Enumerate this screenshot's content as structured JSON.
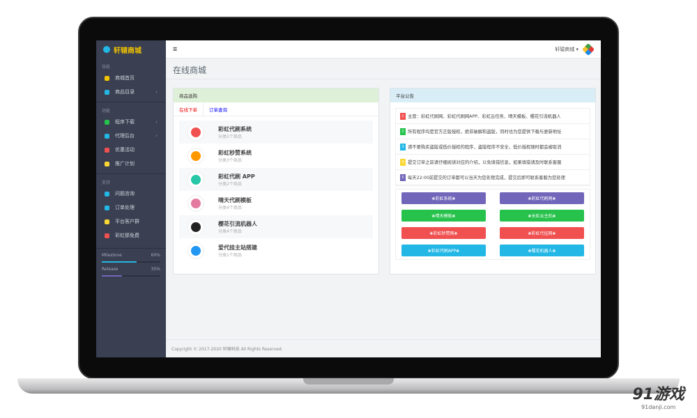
{
  "brand": "轩辕商城",
  "sidebar": {
    "sections": [
      {
        "title": "导航",
        "items": [
          {
            "label": "商城首页",
            "color": "#f2c500",
            "chev": false
          },
          {
            "label": "商品目录",
            "color": "#23b7e5",
            "chev": true
          }
        ]
      },
      {
        "title": "功能",
        "items": [
          {
            "label": "程序下载",
            "color": "#27c24c",
            "chev": true
          },
          {
            "label": "代理后台",
            "color": "#23b7e5",
            "chev": true
          },
          {
            "label": "优惠活动",
            "color": "#f05050",
            "chev": false
          },
          {
            "label": "推广计划",
            "color": "#fad733",
            "chev": false
          }
        ]
      },
      {
        "title": "支持",
        "items": [
          {
            "label": "问题咨询",
            "color": "#23b7e5",
            "chev": false
          },
          {
            "label": "订单处理",
            "color": "#23b7e5",
            "chev": false
          },
          {
            "label": "平台客户群",
            "color": "#fad733",
            "chev": false
          },
          {
            "label": "彩虹那免费",
            "color": "#f05050",
            "chev": false
          }
        ]
      }
    ],
    "progress": [
      {
        "label": "Milestone",
        "value": "60%",
        "percent": 60,
        "color": "#23b7e5"
      },
      {
        "label": "Release",
        "value": "35%",
        "percent": 35,
        "color": "#7266ba"
      }
    ]
  },
  "topbar": {
    "menu_icon": "☰",
    "user": "轩辕商城 ▾"
  },
  "page_title": "在线商城",
  "goods_panel": {
    "title": "商品选购",
    "tabs": [
      "在线下单",
      "订单查询"
    ],
    "items": [
      {
        "name": "彩虹代刷系统",
        "sub": "分类5个商品",
        "color": "#f05050"
      },
      {
        "name": "彩虹秒赞系统",
        "sub": "分类3个商品",
        "color": "#ff9800"
      },
      {
        "name": "彩虹代刷 APP",
        "sub": "分类2个商品",
        "color": "#26c6a6"
      },
      {
        "name": "晴天代刷模板",
        "sub": "分类4个商品",
        "color": "#e57aa0"
      },
      {
        "name": "樱花引流机器人",
        "sub": "分类4个商品",
        "color": "#222222"
      },
      {
        "name": "爱代挂主站搭建",
        "sub": "分类1个商品",
        "color": "#2196f3"
      }
    ]
  },
  "notice_panel": {
    "title": "平台公告",
    "items": [
      {
        "num": "1",
        "color": "#f05050",
        "text": "主营：彩虹代刷网、彩虹代刷网APP、彩虹云任务、晴天模板、樱花引流机器人"
      },
      {
        "num": "2",
        "color": "#27c24c",
        "text": "所有程序均是官方正版授权，绝非破解和盗版，同时也为您提供下载与更新地址"
      },
      {
        "num": "3",
        "color": "#23b7e5",
        "text": "请不要购买盗版或低价授权的程序，盗版程序不安全，低价授权随时都会被取消"
      },
      {
        "num": "4",
        "color": "#fad733",
        "text": "提交订单之前请仔细阅读对应的介绍，以免填错信息，如果填错请及时联系客服"
      },
      {
        "num": "5",
        "color": "#7266ba",
        "text": "每天22:00前提交的订单都可以当天为您处理完成，提交后即可联系客服为您处理"
      }
    ],
    "buttons": [
      {
        "label": "❀彩虹系统❀",
        "color": "#7266ba"
      },
      {
        "label": "❀彩虹代刷网❀",
        "color": "#7266ba"
      },
      {
        "label": "❀晴天模板❀",
        "color": "#27c24c"
      },
      {
        "label": "❀长虹云主机❀",
        "color": "#27c24c"
      },
      {
        "label": "❀彩虹秒赞网❀",
        "color": "#f05050"
      },
      {
        "label": "❀彩虹代挂网❀",
        "color": "#f05050"
      },
      {
        "label": "❀彩虹代刷APP❀",
        "color": "#23b7e5"
      },
      {
        "label": "❀樱花机器人❀",
        "color": "#23b7e5"
      }
    ]
  },
  "footer": "Copyright © 2017-2020 轩辕科技 All Rights Reserved.",
  "watermark": {
    "logo": "91游戏",
    "site": "91danji.com"
  }
}
